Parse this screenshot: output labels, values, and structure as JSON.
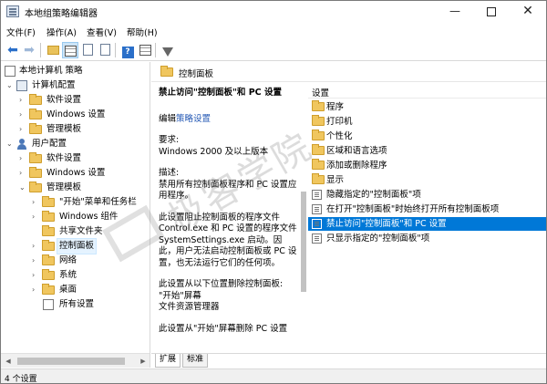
{
  "window": {
    "title": "本地组策略编辑器",
    "minimize_glyph": "—",
    "close_glyph": "✕"
  },
  "menu": [
    "文件(F)",
    "操作(A)",
    "查看(V)",
    "帮助(H)"
  ],
  "toolbar": {
    "back_glyph": "⬅",
    "forward_glyph": "➡",
    "help_glyph": "?"
  },
  "tree": {
    "root": "本地计算机 策略",
    "computer_config": "计算机配置",
    "cc_software": "软件设置",
    "cc_windows": "Windows 设置",
    "cc_admin": "管理模板",
    "user_config": "用户配置",
    "uc_software": "软件设置",
    "uc_windows": "Windows 设置",
    "uc_admin": "管理模板",
    "at_start": "\"开始\"菜单和任务栏",
    "at_components": "Windows 组件",
    "at_shared": "共享文件夹",
    "at_control_panel": "控制面板",
    "at_network": "网络",
    "at_system": "系统",
    "at_desktop": "桌面",
    "at_all": "所有设置",
    "expand_glyph": "›",
    "collapse_glyph": "⌄"
  },
  "right": {
    "header": "控制面板",
    "desc_title": "禁止访问\"控制面板\"和 PC 设置",
    "edit_prefix": "编辑",
    "edit_link": "策略设置",
    "req_label": "要求:",
    "req_value": "Windows 2000 及以上版本",
    "desc_label": "描述:",
    "desc_body": "禁用所有控制面板程序和 PC 设置应用程序。",
    "desc_para2": "此设置阻止控制面板的程序文件 Control.exe 和 PC 设置的程序文件 SystemSettings.exe 启动。因此，用户无法启动控制面板或 PC 设置，也无法运行它们的任何项。",
    "desc_para3": "此设置从以下位置删除控制面板:",
    "desc_loc1": "\"开始\"屏幕",
    "desc_loc2": "文件资源管理器",
    "desc_para4": "此设置从\"开始\"屏幕删除 PC 设置",
    "column_header": "设置",
    "items": [
      {
        "label": "程序",
        "type": "folder"
      },
      {
        "label": "打印机",
        "type": "folder"
      },
      {
        "label": "个性化",
        "type": "folder"
      },
      {
        "label": "区域和语言选项",
        "type": "folder"
      },
      {
        "label": "添加或删除程序",
        "type": "folder"
      },
      {
        "label": "显示",
        "type": "folder"
      },
      {
        "label": "隐藏指定的\"控制面板\"项",
        "type": "policy"
      },
      {
        "label": "在打开\"控制面板\"时始终打开所有控制面板项",
        "type": "policy"
      },
      {
        "label": "禁止访问\"控制面板\"和 PC 设置",
        "type": "policy",
        "selected": true
      },
      {
        "label": "只显示指定的\"控制面板\"项",
        "type": "policy"
      }
    ]
  },
  "tabs": [
    "扩展",
    "标准"
  ],
  "status": "4 个设置",
  "watermark": "极客学院",
  "colors": {
    "selection": "#0078d7",
    "link": "#2559b5",
    "folder": "#f0c65e"
  }
}
